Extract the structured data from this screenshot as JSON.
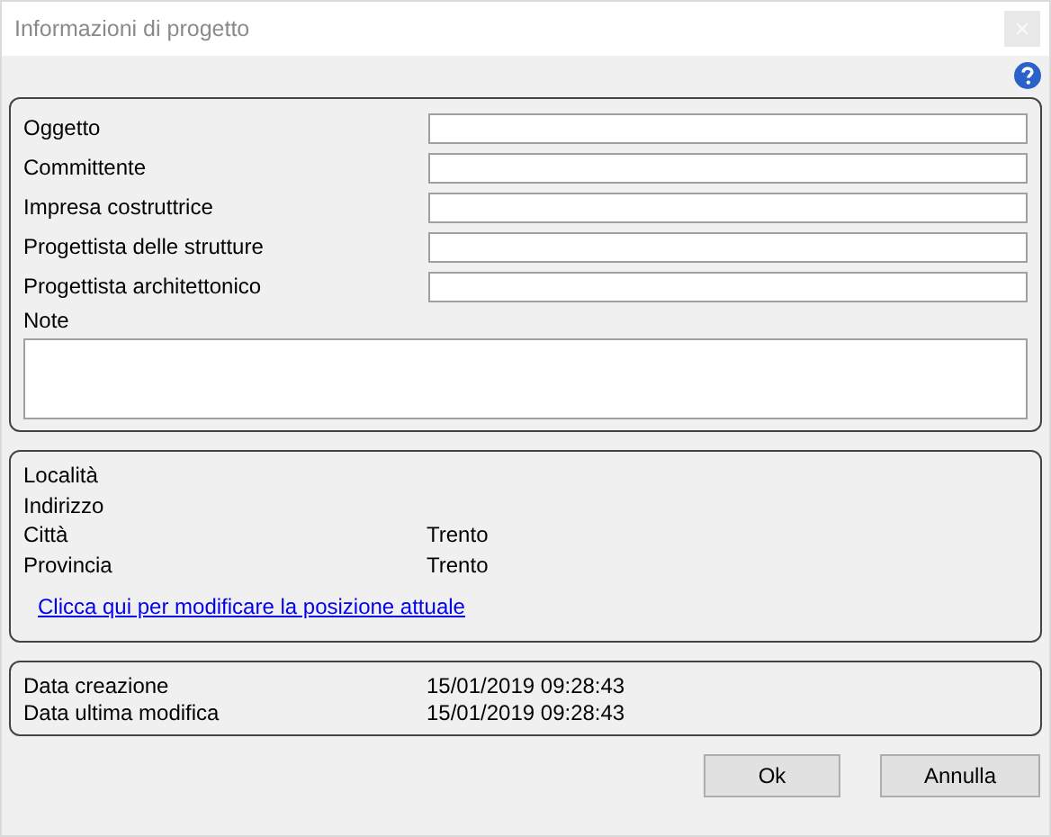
{
  "window": {
    "title": "Informazioni di progetto"
  },
  "project_fields": [
    {
      "label": "Oggetto"
    },
    {
      "label": "Committente"
    },
    {
      "label": "Impresa costruttrice"
    },
    {
      "label": "Progettista delle strutture"
    },
    {
      "label": "Progettista architettonico"
    }
  ],
  "note": {
    "label": "Note"
  },
  "location": {
    "rows": [
      {
        "label": "Località"
      },
      {
        "label": "Indirizzo"
      },
      {
        "label": "Città",
        "value": "Trento"
      },
      {
        "label": "Provincia",
        "value": "Trento"
      }
    ],
    "link": "Clicca qui per modificare la posizione attuale"
  },
  "dates": [
    {
      "label": "Data creazione",
      "value": "15/01/2019 09:28:43"
    },
    {
      "label": "Data ultima modifica",
      "value": "15/01/2019 09:28:43"
    }
  ],
  "buttons": [
    "Ok",
    "Annulla"
  ]
}
